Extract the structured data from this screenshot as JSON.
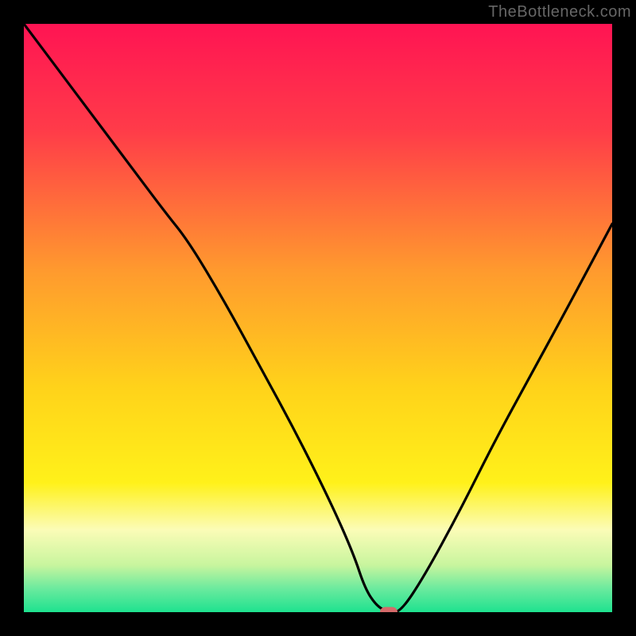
{
  "watermark": "TheBottleneck.com",
  "marker_color": "#d56a6a",
  "chart_data": {
    "type": "line",
    "title": "",
    "xlabel": "",
    "ylabel": "",
    "xlim": [
      0,
      100
    ],
    "ylim": [
      0,
      100
    ],
    "grid": false,
    "legend": false,
    "gradient_stops": [
      {
        "pct": 0,
        "color": "#ff1453"
      },
      {
        "pct": 18,
        "color": "#ff3b49"
      },
      {
        "pct": 42,
        "color": "#ff9a2e"
      },
      {
        "pct": 62,
        "color": "#ffd31a"
      },
      {
        "pct": 78,
        "color": "#fff11a"
      },
      {
        "pct": 86,
        "color": "#fbfcb7"
      },
      {
        "pct": 92,
        "color": "#c8f59e"
      },
      {
        "pct": 96,
        "color": "#6bea9e"
      },
      {
        "pct": 100,
        "color": "#1ee28f"
      }
    ],
    "series": [
      {
        "name": "bottleneck-curve",
        "x": [
          0,
          6,
          12,
          18,
          24,
          28,
          34,
          40,
          46,
          52,
          56,
          58,
          60,
          62,
          64,
          68,
          74,
          80,
          86,
          92,
          100
        ],
        "y": [
          100,
          92,
          84,
          76,
          68,
          63,
          53,
          42,
          31,
          19,
          10,
          4,
          1,
          0,
          0,
          6,
          17,
          29,
          40,
          51,
          66
        ]
      }
    ],
    "annotations": [
      {
        "name": "optimal-marker",
        "x": 62,
        "y": 0
      }
    ]
  }
}
